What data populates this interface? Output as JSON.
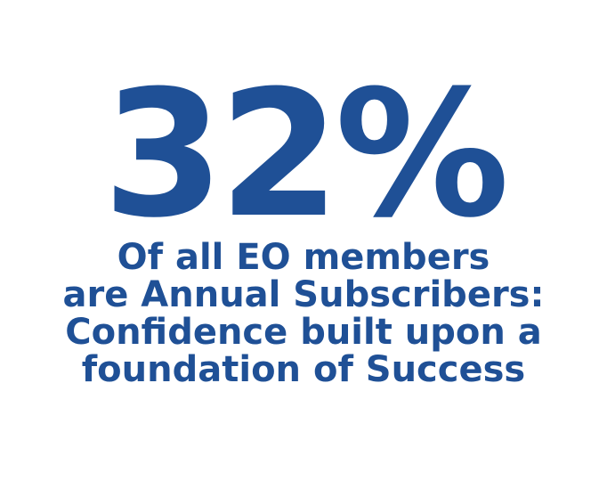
{
  "stat": {
    "value": "32%",
    "caption_lines": [
      "Of all EO members",
      "are Annual Subscribers:",
      "Confidence built upon a",
      "foundation of Success"
    ]
  },
  "colors": {
    "text": "#1f5096",
    "background": "#ffffff"
  }
}
